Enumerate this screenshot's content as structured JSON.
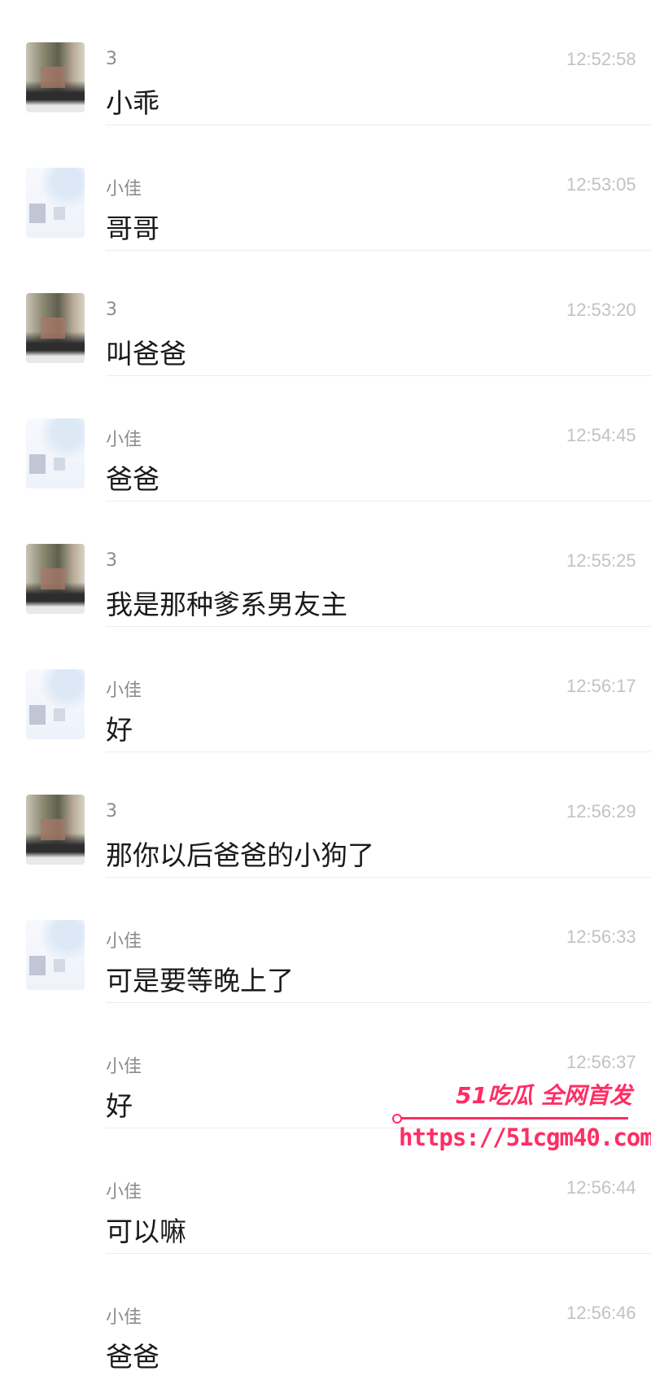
{
  "messages": [
    {
      "sender": "3",
      "time": "12:52:58",
      "text": "小乖",
      "avatar": "three"
    },
    {
      "sender": "小佳",
      "time": "12:53:05",
      "text": "哥哥",
      "avatar": "xj"
    },
    {
      "sender": "3",
      "time": "12:53:20",
      "text": "叫爸爸",
      "avatar": "three"
    },
    {
      "sender": "小佳",
      "time": "12:54:45",
      "text": "爸爸",
      "avatar": "xj"
    },
    {
      "sender": "3",
      "time": "12:55:25",
      "text": "我是那种爹系男友主",
      "avatar": "three"
    },
    {
      "sender": "小佳",
      "time": "12:56:17",
      "text": "好",
      "avatar": "xj"
    },
    {
      "sender": "3",
      "time": "12:56:29",
      "text": "那你以后爸爸的小狗了",
      "avatar": "three"
    },
    {
      "sender": "小佳",
      "time": "12:56:33",
      "text": "可是要等晚上了",
      "avatar": "xj"
    },
    {
      "sender": "小佳",
      "time": "12:56:37",
      "text": "好",
      "avatar": "none"
    },
    {
      "sender": "小佳",
      "time": "12:56:44",
      "text": "可以嘛",
      "avatar": "none"
    },
    {
      "sender": "小佳",
      "time": "12:56:46",
      "text": "爸爸",
      "avatar": "none"
    }
  ],
  "watermark": {
    "headline": "51吃瓜 全网首发",
    "url": "https://51cgm40.com",
    "color": "#ff2d64"
  }
}
